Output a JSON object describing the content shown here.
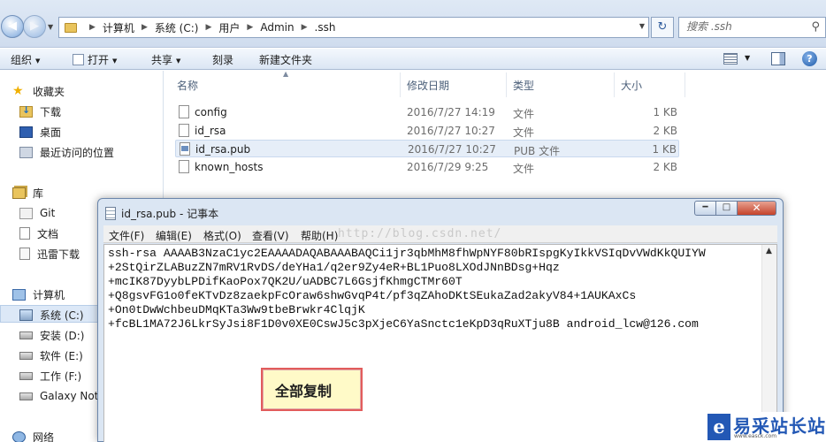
{
  "addressbar": {
    "breadcrumbs": [
      "计算机",
      "系统 (C:)",
      "用户",
      "Admin",
      ".ssh"
    ],
    "search_placeholder": "搜索 .ssh"
  },
  "commandbar": {
    "organize": "组织",
    "open": "打开",
    "share": "共享",
    "burn": "刻录",
    "new_folder": "新建文件夹"
  },
  "navpane": {
    "favorites": {
      "label": "收藏夹",
      "items": [
        "下载",
        "桌面",
        "最近访问的位置"
      ]
    },
    "libraries": {
      "label": "库",
      "items": [
        "Git",
        "文档",
        "迅雷下载"
      ]
    },
    "computer": {
      "label": "计算机",
      "items": [
        "系统 (C:)",
        "安装 (D:)",
        "软件 (E:)",
        "工作 (F:)",
        "Galaxy Not"
      ]
    },
    "network": {
      "label": "网络"
    }
  },
  "filelist": {
    "columns": {
      "name": "名称",
      "date": "修改日期",
      "type": "类型",
      "size": "大小"
    },
    "files": [
      {
        "name": "config",
        "date": "2016/7/27 14:19",
        "type": "文件",
        "size": "1 KB"
      },
      {
        "name": "id_rsa",
        "date": "2016/7/27 10:27",
        "type": "文件",
        "size": "2 KB"
      },
      {
        "name": "id_rsa.pub",
        "date": "2016/7/27 10:27",
        "type": "PUB 文件",
        "size": "1 KB"
      },
      {
        "name": "known_hosts",
        "date": "2016/7/29 9:25",
        "type": "文件",
        "size": "2 KB"
      }
    ]
  },
  "notepad": {
    "title": "id_rsa.pub - 记事本",
    "menus": [
      "文件(F)",
      "编辑(E)",
      "格式(O)",
      "查看(V)",
      "帮助(H)"
    ],
    "watermark": "http://blog.csdn.net/",
    "content_lines": [
      "ssh-rsa AAAAB3NzaC1yc2EAAAADAQABAAABAQCi1jr3qbMhM8fhWpNYF80bRIspgKyIkkVSIqDvVWdKkQUIYW",
      "+2StQirZLABuzZN7mRV1RvDS/deYHa1/q2er9Zy4eR+BL1Puo8LXOdJNnBDsg+Hqz",
      "+mcIK87DyybLPDifKaoPox7QK2U/uADBC7L6GsjfKhmgCTMr60T",
      "+Q8gsvFG1o0feKTvDz8zaekpFcOraw6shwGvqP4t/pf3qZAhoDKtSEukaZad2akyV84+1AUKAxCs",
      "+On0tDwWchbeuDMqKTa3Ww9tbeBrwkr4ClqjK",
      "+fcBL1MA72J6LkrSyJsi8F1D0v0XE0CswJ5c3pXjeC6YaSnctc1eKpD3qRuXTju8B android_lcw@126.com"
    ]
  },
  "annotation": {
    "text": "全部复制"
  },
  "logo": {
    "text": "易采站长站",
    "subtext": "www.easck.com"
  }
}
